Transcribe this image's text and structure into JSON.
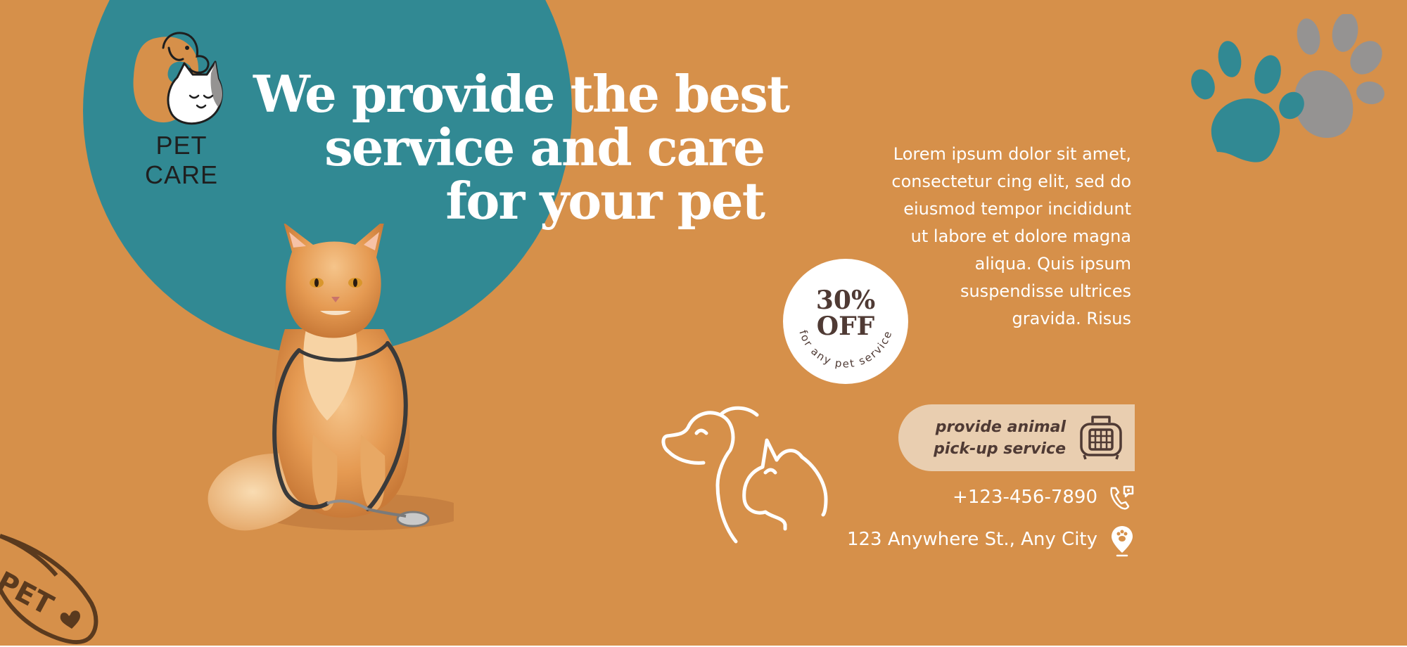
{
  "brand": {
    "name": "PET CARE",
    "logo_icon": "dog-and-cat-logo-icon"
  },
  "headline": {
    "line1": "We provide the best",
    "line2": "service and care",
    "line3": "for your pet"
  },
  "description": {
    "line1": "Lorem ipsum dolor sit amet,",
    "line2": "consectetur cing elit, sed do",
    "line3": "eiusmod tempor incididunt",
    "line4": "ut labore et dolore magna",
    "line5": "aliqua. Quis ipsum",
    "line6": "suspendisse ultrices",
    "line7": "gravida. Risus"
  },
  "discount": {
    "amount": "30%",
    "label": "OFF",
    "caption": "for any pet service"
  },
  "pickup": {
    "line1": "provide animal",
    "line2": "pick-up service",
    "icon": "pet-carrier-icon"
  },
  "contact": {
    "phone": "+123-456-7890",
    "phone_icon": "phone-icon",
    "address": "123 Anywhere St., Any City",
    "address_icon": "location-pin-icon"
  },
  "bowl": {
    "text": "PET"
  },
  "colors": {
    "background": "#d6904a",
    "teal": "#318993",
    "cream": "#e9ceb0",
    "dark_brown": "#4f3a34",
    "paw_gray": "#959392",
    "white": "#ffffff"
  }
}
